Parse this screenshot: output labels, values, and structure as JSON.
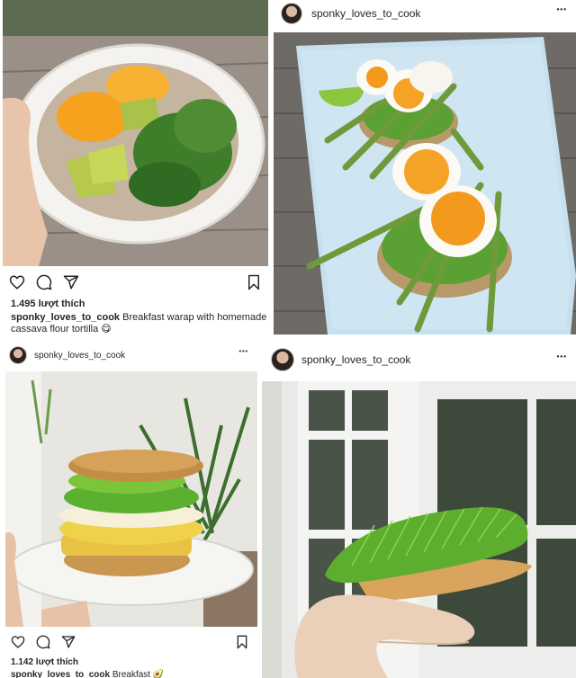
{
  "posts": [
    {
      "id": "post-1",
      "photo_desc": "wrap-plate",
      "likes": "1.495 lượt thích",
      "caption_user": "sponky_loves_to_cook",
      "caption_text": " Breakfast warap with homemade cassava flour tortilla ",
      "caption_emoji": "😋"
    },
    {
      "id": "post-2",
      "username": "sponky_loves_to_cook",
      "more": "•••"
    },
    {
      "id": "post-3",
      "username": "sponky_loves_to_cook",
      "more": "•••",
      "likes": "1.142 lượt thích",
      "caption_user": "sponky_loves_to_cook",
      "caption_text": " Breakfast ",
      "caption_emoji": "🥑"
    },
    {
      "id": "post-4",
      "username": "sponky_loves_to_cook",
      "more": "•••"
    }
  ],
  "colors": {
    "avocado": "#6bb33a",
    "yolk": "#f3a224",
    "plate_blue": "#c7e0ef",
    "deck": "#6e6a66"
  },
  "icons": [
    "heart-icon",
    "comment-icon",
    "share-icon",
    "bookmark-icon",
    "more-icon"
  ]
}
